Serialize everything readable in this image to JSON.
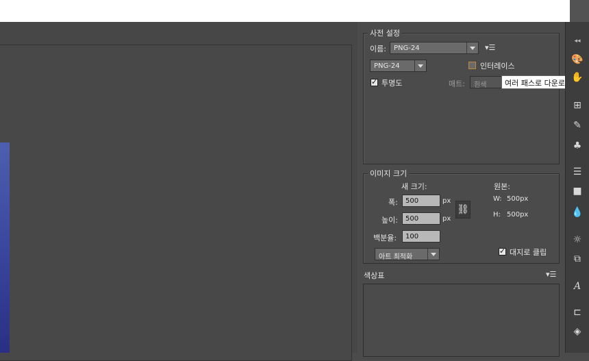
{
  "preset": {
    "title": "사전 설정",
    "name_label": "이름:",
    "name_value": "PNG-24",
    "format_value": "PNG-24",
    "interlace_label": "인터레이스",
    "interlaced": false,
    "transparency_label": "투명도",
    "transparency": true,
    "matte_label": "매트:",
    "matte_value": "흰색",
    "tooltip": "여러 패스로 다운로드"
  },
  "image_size": {
    "title": "이미지 크기",
    "new_size_label": "새 크기:",
    "width_label": "폭:",
    "width_value": "500",
    "height_label": "높이:",
    "height_value": "500",
    "unit": "px",
    "percent_label": "백분율:",
    "percent_value": "100",
    "quality_value": "아트 최적화",
    "original_label": "원본:",
    "orig_w_label": "W:",
    "orig_w_value": "500px",
    "orig_h_label": "H:",
    "orig_h_value": "500px",
    "clip_label": "대지로 클립",
    "clip": true
  },
  "color_table": {
    "title": "색상표"
  },
  "toolbar": {
    "collapse_glyph": "◂◂",
    "icons": [
      "palette-icon",
      "hand-icon",
      "grid-icon",
      "brush-icon",
      "club-icon",
      "lines-icon",
      "square-icon",
      "drop-icon",
      "sun-icon",
      "transform-icon",
      "text-icon",
      "layers-stack-icon",
      "layers-icon"
    ]
  }
}
